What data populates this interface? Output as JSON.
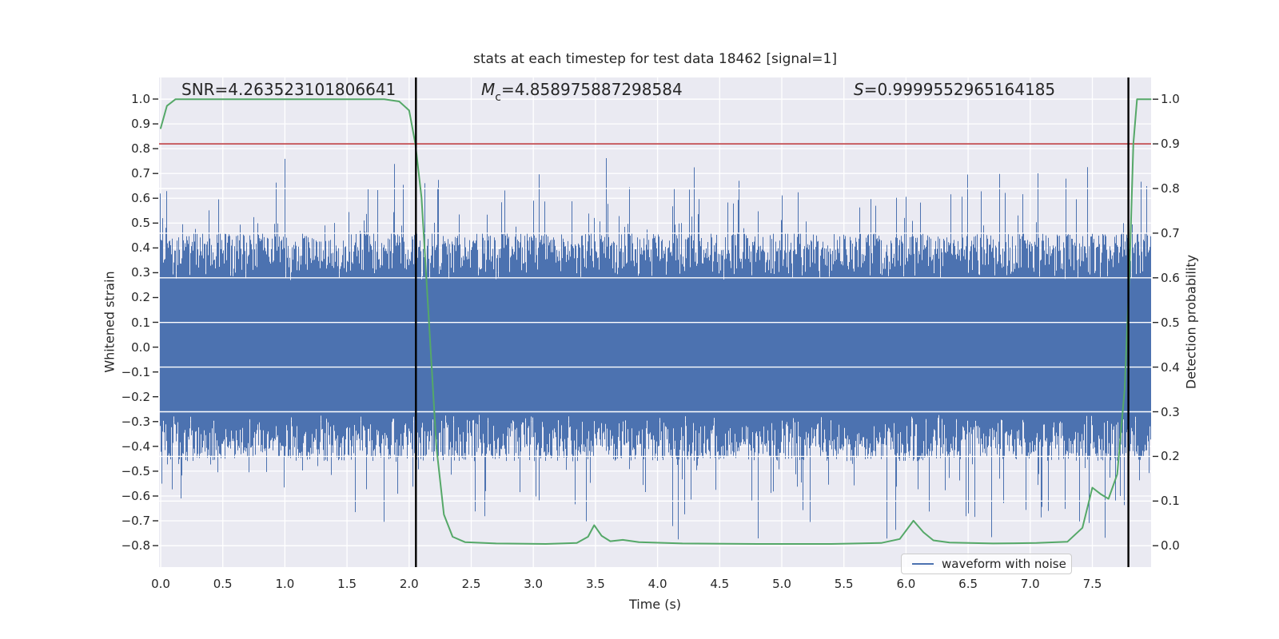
{
  "figure": {
    "title": "stats at each timestep for test data 18462 [signal=1]",
    "annotations": {
      "snr": "SNR=4.263523101806641",
      "mc_symbol": "M",
      "mc_sub": "c",
      "mc_rest": "=4.858975887298584",
      "s_symbol": "S",
      "s_rest": "=0.9999552965164185"
    },
    "axes": {
      "xlabel": "Time (s)",
      "ylabel_left": "Whitened strain",
      "ylabel_right": "Detection probability"
    },
    "legend": {
      "label": "waveform with noise"
    }
  },
  "chart_data": {
    "type": "line",
    "title": "stats at each timestep for test data 18462 [signal=1]",
    "xlabel": "Time (s)",
    "ylabel_left": "Whitened strain",
    "ylabel_right": "Detection probability",
    "x_range_s": [
      0.0,
      7.97
    ],
    "ylim_left": [
      -0.887,
      1.087
    ],
    "ylim_right": [
      -0.048,
      1.048
    ],
    "grid": true,
    "x_ticks": [
      "0.0",
      "0.5",
      "1.0",
      "1.5",
      "2.0",
      "2.5",
      "3.0",
      "3.5",
      "4.0",
      "4.5",
      "5.0",
      "5.5",
      "6.0",
      "6.5",
      "7.0",
      "7.5"
    ],
    "y_ticks_left": [
      "1.0",
      "0.9",
      "0.8",
      "0.7",
      "0.6",
      "0.5",
      "0.4",
      "0.3",
      "0.2",
      "0.1",
      "0.0",
      "−0.1",
      "−0.2",
      "−0.3",
      "−0.4",
      "−0.5",
      "−0.6",
      "−0.7",
      "−0.8"
    ],
    "y_ticks_right": [
      "1.0",
      "0.9",
      "0.8",
      "0.7",
      "0.6",
      "0.5",
      "0.4",
      "0.3",
      "0.2",
      "0.1",
      "0.0"
    ],
    "stats": {
      "SNR": 4.263523101806641,
      "Mc": 4.858975887298584,
      "S": 0.9999552965164185,
      "test_data_id": 18462,
      "signal": 1
    },
    "threshold_line": {
      "axis": "right",
      "value": 0.9,
      "color": "#c44e52"
    },
    "event_marker_lines": {
      "axis": "x",
      "x_values": [
        2.055,
        7.79
      ],
      "color": "#000000"
    },
    "detection_probability_series": {
      "name": "detection probability",
      "axis": "right",
      "color": "#55a868",
      "keypoints": [
        [
          0.0,
          0.935
        ],
        [
          0.05,
          0.985
        ],
        [
          0.12,
          1.0
        ],
        [
          1.8,
          1.0
        ],
        [
          1.92,
          0.995
        ],
        [
          2.0,
          0.975
        ],
        [
          2.05,
          0.9
        ],
        [
          2.1,
          0.78
        ],
        [
          2.16,
          0.5
        ],
        [
          2.22,
          0.22
        ],
        [
          2.28,
          0.07
        ],
        [
          2.35,
          0.02
        ],
        [
          2.45,
          0.008
        ],
        [
          2.7,
          0.005
        ],
        [
          3.1,
          0.004
        ],
        [
          3.35,
          0.006
        ],
        [
          3.44,
          0.02
        ],
        [
          3.49,
          0.046
        ],
        [
          3.55,
          0.022
        ],
        [
          3.62,
          0.01
        ],
        [
          3.72,
          0.013
        ],
        [
          3.85,
          0.008
        ],
        [
          4.2,
          0.005
        ],
        [
          4.8,
          0.004
        ],
        [
          5.4,
          0.004
        ],
        [
          5.8,
          0.006
        ],
        [
          5.95,
          0.015
        ],
        [
          6.06,
          0.056
        ],
        [
          6.14,
          0.03
        ],
        [
          6.22,
          0.012
        ],
        [
          6.35,
          0.007
        ],
        [
          6.7,
          0.005
        ],
        [
          7.05,
          0.006
        ],
        [
          7.3,
          0.009
        ],
        [
          7.42,
          0.04
        ],
        [
          7.5,
          0.13
        ],
        [
          7.57,
          0.115
        ],
        [
          7.63,
          0.105
        ],
        [
          7.7,
          0.16
        ],
        [
          7.76,
          0.35
        ],
        [
          7.8,
          0.62
        ],
        [
          7.83,
          0.9
        ],
        [
          7.86,
          1.0
        ],
        [
          7.97,
          1.0
        ]
      ]
    },
    "waveform_series": {
      "label": "waveform with noise",
      "axis": "left",
      "color": "#4c72b0",
      "appearance": "dense whitened gaussian noise band",
      "core_halfwidth": 0.28,
      "typical_extent": 0.46,
      "max_extent": 0.78,
      "seed": 18462,
      "n_columns": 1240
    },
    "legend": {
      "label": "waveform with noise",
      "position": "lower right"
    },
    "colors": {
      "plot_background": "#eaeaf2",
      "gridline": "#ffffff",
      "waveform": "#4c72b0",
      "probability": "#55a868",
      "threshold": "#c44e52",
      "marker": "#000000",
      "text": "#262626"
    }
  }
}
